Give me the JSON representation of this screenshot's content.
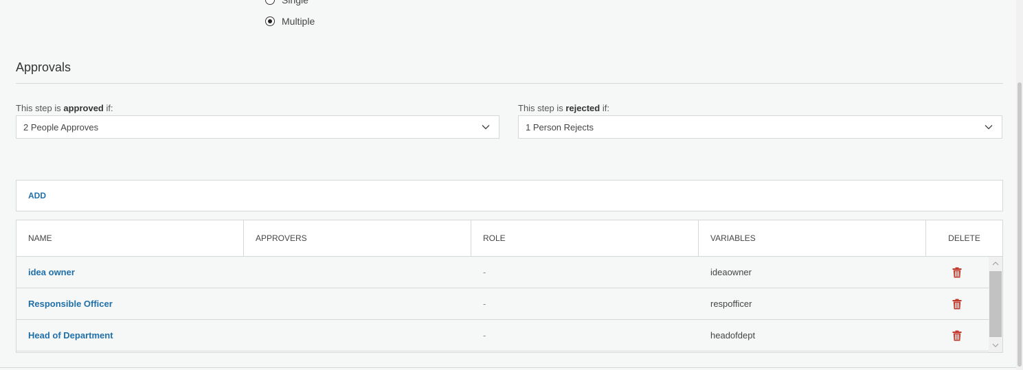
{
  "selection_mode": {
    "options": [
      {
        "label": "Single",
        "checked": false
      },
      {
        "label": "Multiple",
        "checked": true
      }
    ]
  },
  "approvals": {
    "title": "Approvals",
    "approved": {
      "label_prefix": "This step is ",
      "label_bold": "approved",
      "label_suffix": " if:",
      "value": "2 People Approves"
    },
    "rejected": {
      "label_prefix": "This step is ",
      "label_bold": "rejected",
      "label_suffix": " if:",
      "value": "1 Person Rejects"
    }
  },
  "add_label": "ADD",
  "table": {
    "headers": [
      "NAME",
      "APPROVERS",
      "ROLE",
      "VARIABLES",
      "DELETE"
    ],
    "rows": [
      {
        "name": "idea owner",
        "approvers": "",
        "role": "-",
        "variables": "ideaowner"
      },
      {
        "name": "Responsible Officer",
        "approvers": "",
        "role": "-",
        "variables": "respofficer"
      },
      {
        "name": "Head of Department",
        "approvers": "",
        "role": "-",
        "variables": "headofdept"
      }
    ]
  },
  "icons": {
    "delete": "trash-icon",
    "dropdown": "chevron-down-icon"
  },
  "colors": {
    "link": "#1f6fa8",
    "delete": "#c0392b",
    "border": "#d5d8da",
    "background": "#f6f7f7"
  }
}
